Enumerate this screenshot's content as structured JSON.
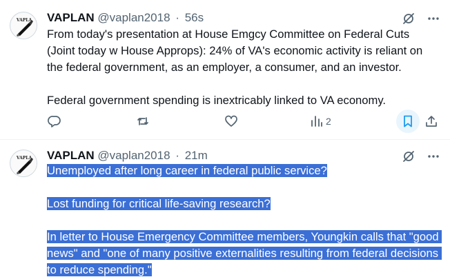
{
  "tweets": [
    {
      "name": "VAPLAN",
      "handle": "@vaplan2018",
      "separator": "·",
      "time": "56s",
      "paragraphs": [
        "From today's presentation at House Emgcy Committee on Federal Cuts (Joint today w House Approps): 24% of VA's economic activity is reliant on the federal government, as an employer, a consumer, and an investor.",
        "Federal government spending is inextricably linked to VA economy."
      ],
      "views": "2",
      "icons": [
        "grok-icon",
        "more-icon",
        "reply-icon",
        "retweet-icon",
        "like-icon",
        "views-icon",
        "bookmark-icon",
        "share-icon"
      ]
    },
    {
      "name": "VAPLAN",
      "handle": "@vaplan2018",
      "separator": "·",
      "time": "21m",
      "paragraphs": [
        "Unemployed after long career in federal public service?",
        "Lost funding for critical life-saving research?",
        "In letter to House Emergency Committee members, Youngkin calls that \"good news\" and \"one of many positive externalities resulting from federal decisions to reduce spending.\""
      ],
      "selection_color": "#3b6fd6"
    }
  ],
  "colors": {
    "text": "#0f1419",
    "secondary": "#536471",
    "accent": "#1d9bf0",
    "bookmark_active": "#1d9bf0"
  }
}
